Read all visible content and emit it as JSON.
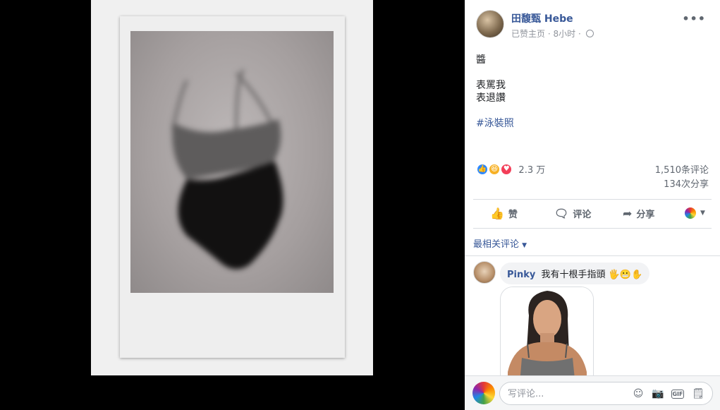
{
  "post": {
    "author": "田馥甄 Hebe",
    "meta_page": "已赞主页",
    "meta_sep": "·",
    "meta_time": "8小时",
    "more_label": "•••",
    "lines": [
      "醬",
      "表罵我",
      "表退讚"
    ],
    "hashtag": "#泳裝照"
  },
  "reactions": {
    "types": [
      "like",
      "haha",
      "love"
    ],
    "count": "2.3 万",
    "comments": "1,510条评论",
    "shares": "134次分享"
  },
  "actions": {
    "like": "赞",
    "comment": "评论",
    "share": "分享"
  },
  "sort": {
    "label": "最相关评论"
  },
  "comment": {
    "author": "Pinky",
    "text": "我有十根手指頭",
    "emojis": "🖐😬✋"
  },
  "composer": {
    "placeholder": "写评论...",
    "gif_label": "GIF"
  },
  "colors": {
    "link": "#385898",
    "like_blue": "#2e89ff",
    "haha_yellow": "#f7b125",
    "love_red": "#f33e58"
  }
}
